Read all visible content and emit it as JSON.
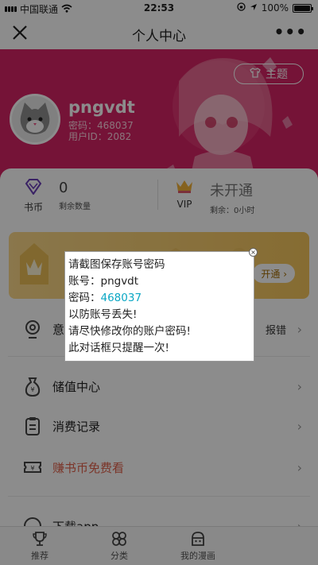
{
  "status": {
    "carrier": "中国联通",
    "time": "22:53",
    "battery": "100%",
    "battery_level": 1.0
  },
  "nav": {
    "title": "个人中心",
    "more": "•••"
  },
  "header": {
    "theme_label": "主题",
    "username": "pngvdt",
    "password_line": "密码：468037",
    "userid_line": "用户ID：2082"
  },
  "stats": {
    "coins_label": "书币",
    "coins_value": "0",
    "coins_caption": "剩余数量",
    "vip_label": "VIP",
    "vip_status": "未开通",
    "vip_caption": "剩余：0小时"
  },
  "vip_banner": {
    "open_label": "开通 ›"
  },
  "menu": {
    "feedback": {
      "label": "意",
      "extra": "报错"
    },
    "recharge": {
      "label": "储值中心"
    },
    "records": {
      "label": "消费记录"
    },
    "earn": {
      "label": "赚书币免费看"
    },
    "download": {
      "label": "下载app"
    }
  },
  "tabs": [
    {
      "label": "推荐"
    },
    {
      "label": "分类"
    },
    {
      "label": "我的漫画"
    }
  ],
  "dialog": {
    "line1": "请截图保存账号密码",
    "account_prefix": "账号：",
    "account_value": "pngvdt",
    "password_prefix": "密码：",
    "password_value": "468037",
    "line4": "以防账号丢失!",
    "line5": "请尽快修改你的账户密码!",
    "line6": "此对话框只提醒一次!",
    "close": "×"
  },
  "colors": {
    "header_bg": "#d62364",
    "earn_text": "#e0604a",
    "password_highlight": "#0aa7c4",
    "vip_gold": "#f5c55c"
  }
}
